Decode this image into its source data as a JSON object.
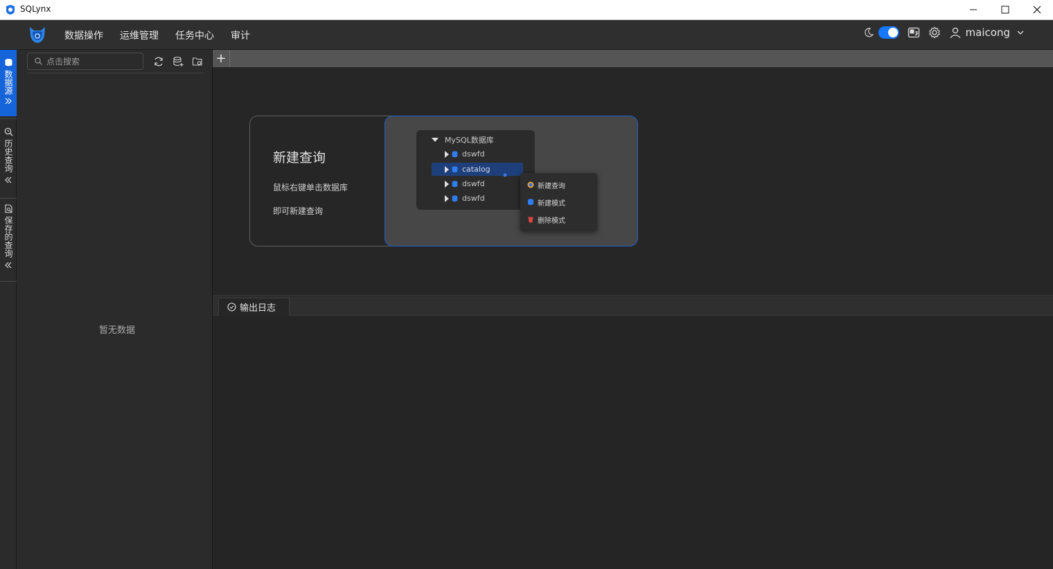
{
  "window": {
    "title": "SQLynx"
  },
  "nav": {
    "menu": [
      "数据操作",
      "运维管理",
      "任务中心",
      "审计"
    ],
    "username": "maicong",
    "dark_mode_on": true,
    "accent": "#1677ff"
  },
  "rail": {
    "tabs": [
      {
        "label": "数据源",
        "icon": "database-icon",
        "active": true
      },
      {
        "label": "历史查询",
        "icon": "search-history-icon",
        "active": false
      },
      {
        "label": "保存的查询",
        "icon": "saved-query-icon",
        "active": false
      }
    ]
  },
  "sidebar": {
    "search_placeholder": "点击搜索",
    "empty_text": "暂无数据",
    "tools": [
      "refresh-icon",
      "add-datasource-icon",
      "datasource-settings-icon"
    ]
  },
  "tabstrip": {
    "add_label": "+"
  },
  "guide": {
    "title": "新建查询",
    "line1": "鼠标右键单击数据库",
    "line2": "即可新建查询",
    "tree": {
      "root": "MySQL数据库",
      "children": [
        "dswfd",
        "catalog",
        "dswfd",
        "dswfd"
      ],
      "selected_index": 1
    },
    "context_menu": [
      "新建查询",
      "新建模式",
      "删除模式"
    ]
  },
  "log": {
    "tab_label": "输出日志"
  }
}
